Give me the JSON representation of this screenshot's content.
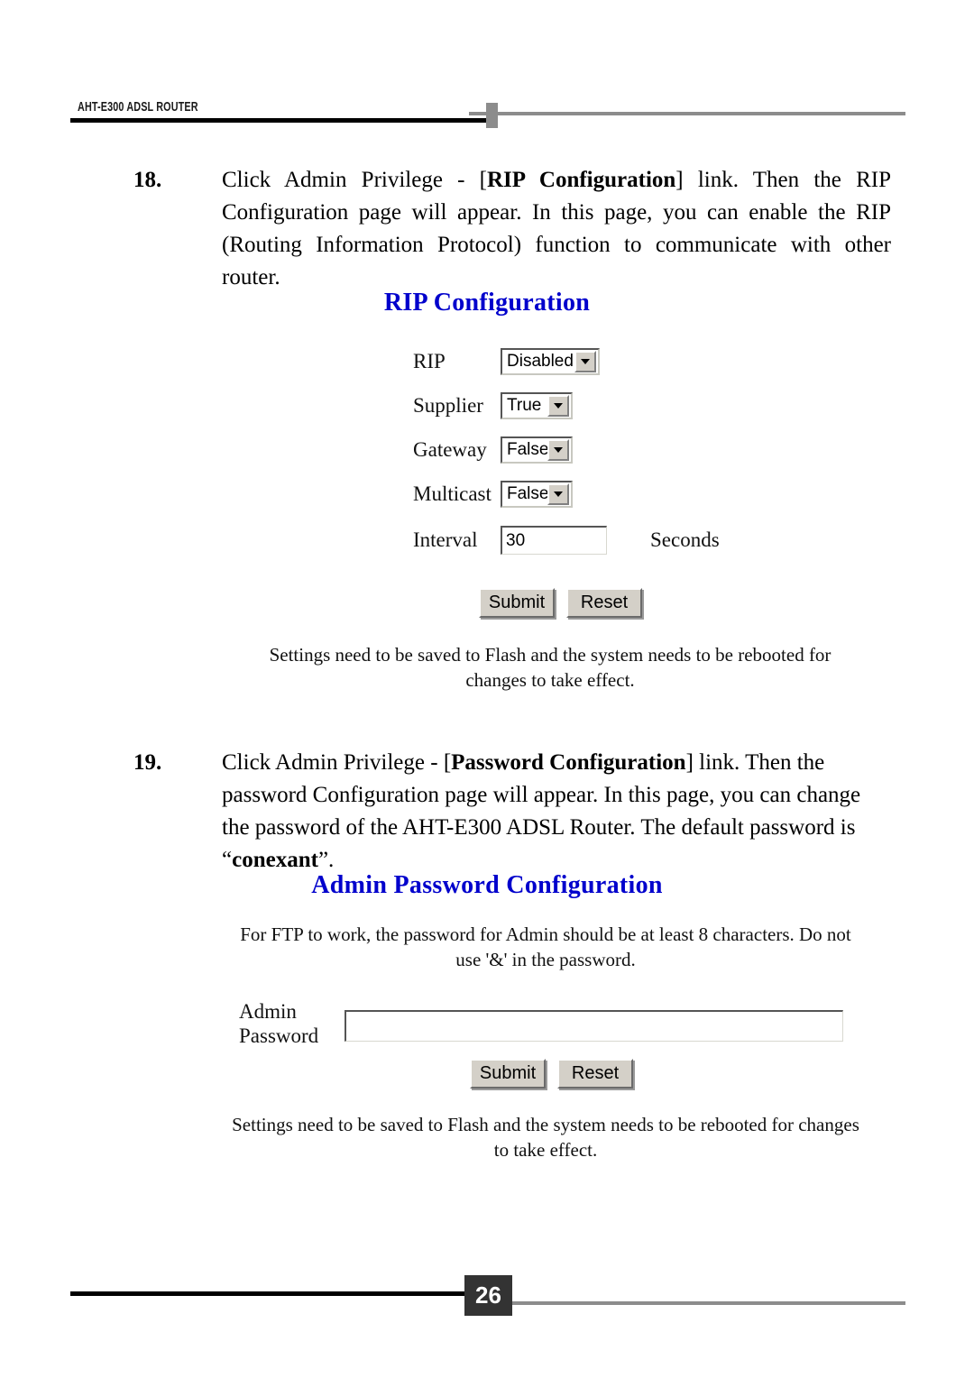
{
  "header": {
    "running_title": "AHT-E300 ADSL ROUTER"
  },
  "footer": {
    "page_number": "26"
  },
  "steps": [
    {
      "number": "18.",
      "text_before": "Click Admin Privilege - [",
      "bold": "RIP Configuration",
      "text_after": "] link. Then the RIP Configuration page will appear. In this page, you can enable the RIP (Routing Information Protocol) function to communicate with other router."
    },
    {
      "number": "19.",
      "text_before": "Click Admin Privilege - [",
      "bold": "Password Configuration",
      "text_after": "] link. Then the password Configuration page will appear. In this page, you can change the password of the AHT-E300 ADSL Router. The default password is “",
      "bold2": "conexant",
      "text_after2": "”."
    }
  ],
  "rip_screenshot": {
    "heading": "RIP Configuration",
    "fields": [
      {
        "label": "RIP",
        "control": "select",
        "value": "Disabled"
      },
      {
        "label": "Supplier",
        "control": "select",
        "value": "True"
      },
      {
        "label": "Gateway",
        "control": "select",
        "value": "False"
      },
      {
        "label": "Multicast",
        "control": "select",
        "value": "False"
      },
      {
        "label": "Interval",
        "control": "input",
        "value": "30",
        "suffix": "Seconds"
      }
    ],
    "submit_label": "Submit",
    "reset_label": "Reset",
    "note_line1": "Settings need to be saved to Flash and the system needs to be rebooted for",
    "note_line2": "changes to take effect."
  },
  "password_screenshot": {
    "heading": "Admin Password Configuration",
    "info_line1": "For FTP to work, the password for Admin should be at least 8 characters. Do not",
    "info_line2": "use '&' in the password.",
    "label_line1": "Admin",
    "label_line2": "Password",
    "password_value": "",
    "submit_label": "Submit",
    "reset_label": "Reset",
    "note_line1": "Settings need to be saved to Flash and the system needs to be rebooted for changes",
    "note_line2": "to take effect."
  },
  "colors": {
    "heading_blue": "#0000cc",
    "rule_black": "#000000",
    "rule_gray": "#8c8c8c",
    "page_box": "#333333",
    "win_face": "#d4d0c8"
  }
}
